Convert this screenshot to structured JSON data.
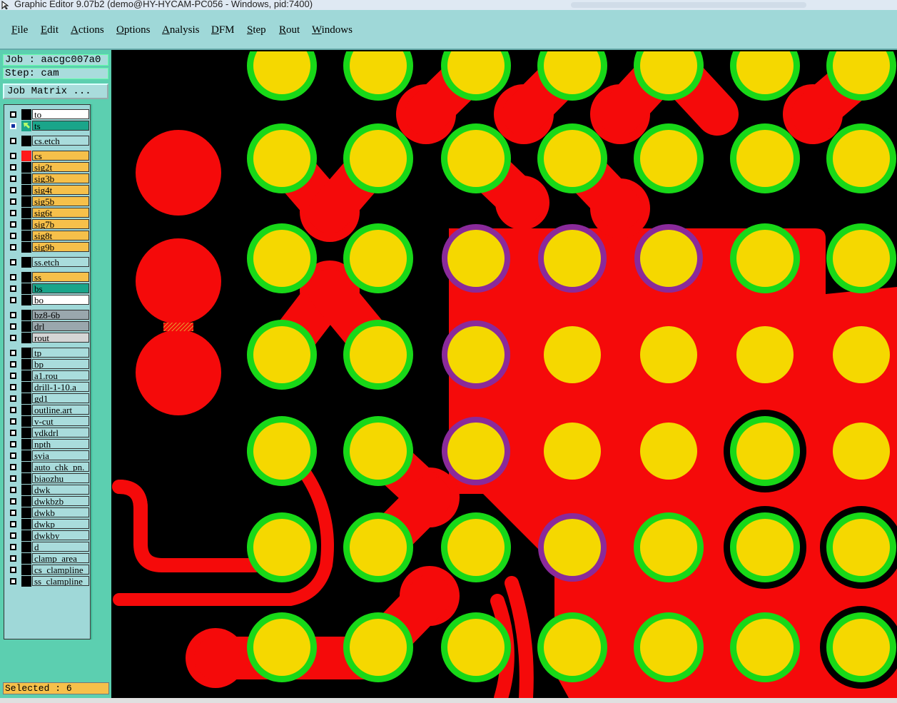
{
  "window": {
    "title": "Graphic Editor 9.07b2 (demo@HY-HYCAM-PC056 - Windows, pid:7400)"
  },
  "menu": [
    {
      "label": "File",
      "mnemonic": "F",
      "rest": "ile"
    },
    {
      "label": "Edit",
      "mnemonic": "E",
      "rest": "dit"
    },
    {
      "label": "Actions",
      "mnemonic": "A",
      "rest": "ctions"
    },
    {
      "label": "Options",
      "mnemonic": "O",
      "rest": "ptions"
    },
    {
      "label": "Analysis",
      "mnemonic": "A",
      "rest": "nalysis"
    },
    {
      "label": "DFM",
      "mnemonic": "D",
      "rest": "FM"
    },
    {
      "label": "Step",
      "mnemonic": "S",
      "rest": "tep"
    },
    {
      "label": "Rout",
      "mnemonic": "R",
      "rest": "out"
    },
    {
      "label": "Windows",
      "mnemonic": "W",
      "rest": "indows"
    }
  ],
  "panel": {
    "job": "Job : aacgc007a0",
    "step": "Step: cam",
    "job_matrix": "Job Matrix ...",
    "status": "Selected : 6"
  },
  "layers": [
    {
      "name": "to",
      "bg": "#ffffff",
      "swatch": "#000000"
    },
    {
      "name": "ts",
      "bg": "#1aa58a",
      "swatch": "#1aa58a",
      "active": true
    },
    {
      "name": "cs.etch",
      "bg": "#a9dcdc",
      "swatch": "#000000"
    },
    {
      "name": "cs",
      "bg": "#f6c04a",
      "swatch": "#ff1a1a"
    },
    {
      "name": "sig2t",
      "bg": "#f6c04a",
      "swatch": "#000000"
    },
    {
      "name": "sig3b",
      "bg": "#f6c04a",
      "swatch": "#000000"
    },
    {
      "name": "sig4t",
      "bg": "#f6c04a",
      "swatch": "#000000"
    },
    {
      "name": "sig5b",
      "bg": "#f6c04a",
      "swatch": "#000000"
    },
    {
      "name": "sig6t",
      "bg": "#f6c04a",
      "swatch": "#000000"
    },
    {
      "name": "sig7b",
      "bg": "#f6c04a",
      "swatch": "#000000"
    },
    {
      "name": "sig8t",
      "bg": "#f6c04a",
      "swatch": "#000000"
    },
    {
      "name": "sig9b",
      "bg": "#f6c04a",
      "swatch": "#000000"
    },
    {
      "name": "ss.etch",
      "bg": "#a9dcdc",
      "swatch": "#000000"
    },
    {
      "name": "ss",
      "bg": "#f6c04a",
      "swatch": "#000000"
    },
    {
      "name": "bs",
      "bg": "#1aa58a",
      "swatch": "#000000"
    },
    {
      "name": "bo",
      "bg": "#ffffff",
      "swatch": "#000000"
    },
    {
      "name": "bz8-6b",
      "bg": "#9aa7ad",
      "swatch": "#000000"
    },
    {
      "name": "drl",
      "bg": "#9aa7ad",
      "swatch": "#000000"
    },
    {
      "name": "rout",
      "bg": "#d5d5d5",
      "swatch": "#000000"
    },
    {
      "name": "tp",
      "bg": "#a9dcdc",
      "swatch": "#000000"
    },
    {
      "name": "bp",
      "bg": "#a9dcdc",
      "swatch": "#000000"
    },
    {
      "name": "a1.rou",
      "bg": "#a9dcdc",
      "swatch": "#000000"
    },
    {
      "name": "drill-1-10.a",
      "bg": "#a9dcdc",
      "swatch": "#000000"
    },
    {
      "name": "gd1",
      "bg": "#a9dcdc",
      "swatch": "#000000"
    },
    {
      "name": "outline.art",
      "bg": "#a9dcdc",
      "swatch": "#000000"
    },
    {
      "name": "v-cut",
      "bg": "#a9dcdc",
      "swatch": "#000000"
    },
    {
      "name": "ydkdrl",
      "bg": "#a9dcdc",
      "swatch": "#000000"
    },
    {
      "name": "npth",
      "bg": "#a9dcdc",
      "swatch": "#000000"
    },
    {
      "name": "svia",
      "bg": "#a9dcdc",
      "swatch": "#000000"
    },
    {
      "name": "auto_chk_pn.",
      "bg": "#a9dcdc",
      "swatch": "#000000"
    },
    {
      "name": "biaozhu",
      "bg": "#a9dcdc",
      "swatch": "#000000"
    },
    {
      "name": "dwk",
      "bg": "#a9dcdc",
      "swatch": "#000000"
    },
    {
      "name": "dwkbzb",
      "bg": "#a9dcdc",
      "swatch": "#000000"
    },
    {
      "name": "dwkb",
      "bg": "#a9dcdc",
      "swatch": "#000000"
    },
    {
      "name": "dwkp",
      "bg": "#a9dcdc",
      "swatch": "#000000"
    },
    {
      "name": "dwkby",
      "bg": "#a9dcdc",
      "swatch": "#000000"
    },
    {
      "name": "d",
      "bg": "#a9dcdc",
      "swatch": "#000000"
    },
    {
      "name": "clamp_area",
      "bg": "#a9dcdc",
      "swatch": "#000000"
    },
    {
      "name": "cs_clampline",
      "bg": "#a9dcdc",
      "swatch": "#000000"
    },
    {
      "name": "ss_clampline",
      "bg": "#a9dcdc",
      "swatch": "#000000"
    }
  ],
  "colors": {
    "copper": "#f50a0a",
    "pad": "#f5d800",
    "ring": "#18d818",
    "highlight": "#8a2a9a",
    "background": "#000000"
  }
}
